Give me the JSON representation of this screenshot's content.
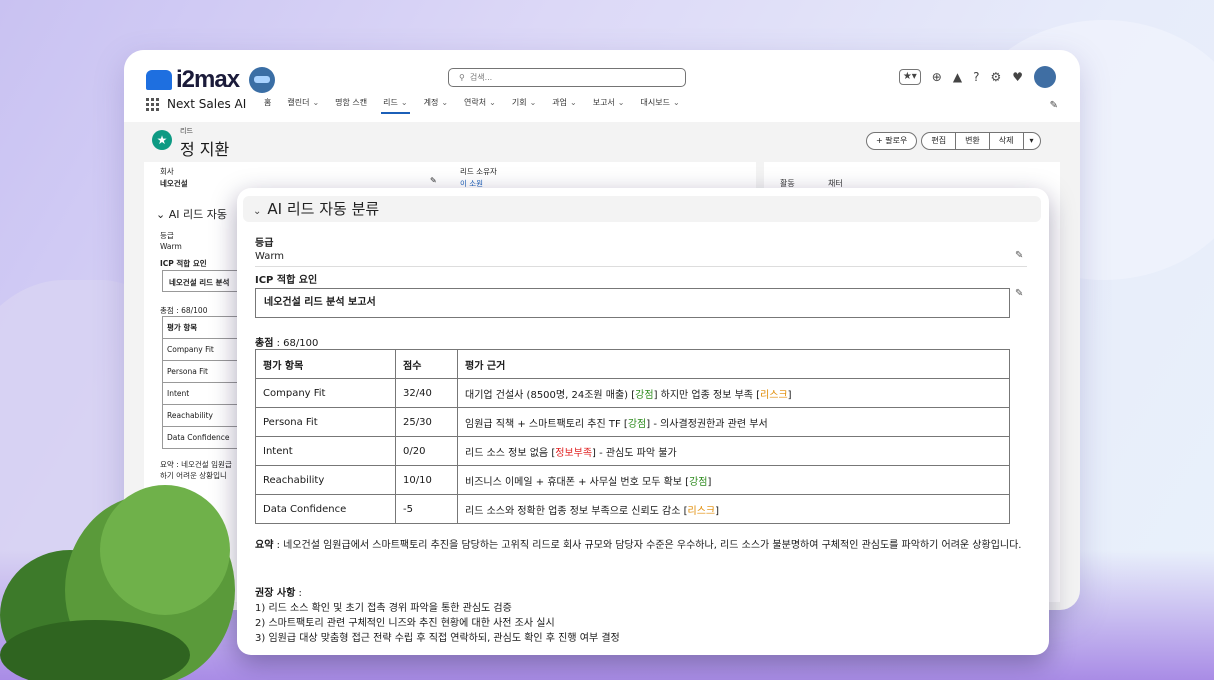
{
  "brand": {
    "logo_text": "i2max",
    "app_name": "Next Sales AI"
  },
  "search": {
    "placeholder": "검색..."
  },
  "nav": [
    {
      "label": "홈",
      "dropdown": false
    },
    {
      "label": "캘린더",
      "dropdown": true
    },
    {
      "label": "명함 스캔",
      "dropdown": false
    },
    {
      "label": "리드",
      "dropdown": true,
      "active": true
    },
    {
      "label": "계정",
      "dropdown": true
    },
    {
      "label": "연락처",
      "dropdown": true
    },
    {
      "label": "기회",
      "dropdown": true
    },
    {
      "label": "과업",
      "dropdown": true
    },
    {
      "label": "보고서",
      "dropdown": true
    },
    {
      "label": "대시보드",
      "dropdown": true
    }
  ],
  "record": {
    "object_label": "리드",
    "name": "정 지환"
  },
  "actions": {
    "follow": "+ 팔로우",
    "edit": "편집",
    "convert": "변환",
    "delete": "삭제"
  },
  "left_panel": {
    "company_label": "회사",
    "company_value": "네오건설",
    "owner_label": "리드 소유자",
    "owner_value": "이 소원",
    "section_title": "AI 리드 자동",
    "grade_label": "등급",
    "grade_value": "Warm",
    "icp_label": "ICP 적합 요인",
    "icp_value": "네오건설 리드 분석",
    "score_text": "총점 : 68/100",
    "table_rows": [
      "평가 항목",
      "Company Fit",
      "Persona Fit",
      "Intent",
      "Reachability",
      "Data Confidence"
    ],
    "summary_snip": "요약 : 네오건설 임원급",
    "summary_snip2": "하기 어려운 상황입니"
  },
  "right_panel": {
    "tab1": "활동",
    "tab2": "채터"
  },
  "card": {
    "title": "AI 리드 자동 분류",
    "grade_label": "등급",
    "grade_value": "Warm",
    "icp_label": "ICP 적합 요인",
    "icp_value": "네오건설 리드 분석 보고서",
    "score_label": "총점",
    "score_value": " : 68/100",
    "table": {
      "headers": [
        "평가 항목",
        "점수",
        "평가 근거"
      ],
      "rows": [
        {
          "item": "Company Fit",
          "score": "32/40",
          "basis_pre": "대기업 건설사 (8500명, 24조원 매출) [",
          "tag1": "강점",
          "tag1_color": "green",
          "basis_mid": "] 하지만 업종 정보 부족 [",
          "tag2": "리스크",
          "tag2_color": "orange",
          "basis_post": "]"
        },
        {
          "item": "Persona Fit",
          "score": "25/30",
          "basis_pre": "임원급 직책 + 스마트팩토리 추진 TF [",
          "tag1": "강점",
          "tag1_color": "green",
          "basis_mid": "] - 의사결정권한과 관련 부서",
          "tag2": "",
          "tag2_color": "",
          "basis_post": ""
        },
        {
          "item": "Intent",
          "score": "0/20",
          "basis_pre": "리드 소스 정보 없음 [",
          "tag1": "정보부족",
          "tag1_color": "red",
          "basis_mid": "] - 관심도 파악 불가",
          "tag2": "",
          "tag2_color": "",
          "basis_post": ""
        },
        {
          "item": "Reachability",
          "score": "10/10",
          "basis_pre": "비즈니스 이메일 + 휴대폰 + 사무실 번호 모두 확보 [",
          "tag1": "강점",
          "tag1_color": "green",
          "basis_mid": "]",
          "tag2": "",
          "tag2_color": "",
          "basis_post": ""
        },
        {
          "item": "Data Confidence",
          "score": "-5",
          "basis_pre": "리드 소스와 정확한 업종 정보 부족으로 신뢰도 감소 [",
          "tag1": "리스크",
          "tag1_color": "orange",
          "basis_mid": "]",
          "tag2": "",
          "tag2_color": "",
          "basis_post": ""
        }
      ]
    },
    "summary_label": "요약",
    "summary_text": " : 네오건설 임원급에서 스마트팩토리 추진을 담당하는 고위직 리드로 회사 규모와 담당자 수준은 우수하나, 리드 소스가 불분명하여 구체적인 관심도를 파악하기 어려운 상황입니다.",
    "recs_label": "권장 사항",
    "recs_colon": " :",
    "recs": [
      "1) 리드 소스 확인 및 초기 접촉 경위 파악을 통한 관심도 검증",
      "2) 스마트팩토리 관련 구체적인 니즈와 추진 현황에 대한 사전 조사 실시",
      "3) 임원급 대상 맞춤형 접근 전략 수립 후 직접 연락하되, 관심도 확인 후 진행 여부 결정"
    ]
  },
  "colors": {
    "green": "#2e8b1e",
    "orange": "#e08a00",
    "red": "#e02020",
    "accent": "#1b5fb8",
    "record_icon": "#0d9a83"
  }
}
